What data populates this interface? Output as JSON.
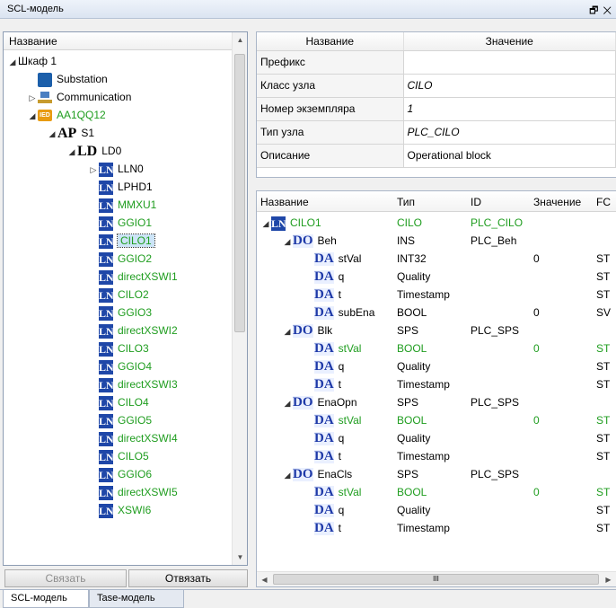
{
  "window": {
    "title": "SCL-модель",
    "pin_glyph": "🗗",
    "close_glyph": "✕"
  },
  "tree_panel": {
    "header": "Название",
    "items": [
      {
        "label": "Шкаф 1",
        "kind": "folder",
        "depth": 0,
        "expander": "◢",
        "color": "normal"
      },
      {
        "label": "Substation",
        "kind": "substation",
        "depth": 1,
        "expander": "",
        "color": "normal"
      },
      {
        "label": "Communication",
        "kind": "communication",
        "depth": 1,
        "expander": "▷",
        "color": "normal"
      },
      {
        "label": "AA1QQ12",
        "kind": "ied",
        "depth": 1,
        "expander": "◢",
        "color": "green",
        "icon_text": "IED"
      },
      {
        "label": "S1",
        "kind": "ap",
        "depth": 2,
        "expander": "◢",
        "color": "normal",
        "icon_text": "AP"
      },
      {
        "label": "LD0",
        "kind": "ld",
        "depth": 3,
        "expander": "◢",
        "color": "normal",
        "icon_text": "LD"
      },
      {
        "label": "LLN0",
        "kind": "ln",
        "depth": 4,
        "expander": "▷",
        "color": "normal"
      },
      {
        "label": "LPHD1",
        "kind": "ln",
        "depth": 4,
        "expander": "",
        "color": "normal"
      },
      {
        "label": "MMXU1",
        "kind": "ln",
        "depth": 4,
        "expander": "",
        "color": "green"
      },
      {
        "label": "GGIO1",
        "kind": "ln",
        "depth": 4,
        "expander": "",
        "color": "green"
      },
      {
        "label": "CILO1",
        "kind": "ln",
        "depth": 4,
        "expander": "",
        "color": "green",
        "selected": true
      },
      {
        "label": "GGIO2",
        "kind": "ln",
        "depth": 4,
        "expander": "",
        "color": "green"
      },
      {
        "label": "directXSWI1",
        "kind": "ln",
        "depth": 4,
        "expander": "",
        "color": "green"
      },
      {
        "label": "CILO2",
        "kind": "ln",
        "depth": 4,
        "expander": "",
        "color": "green"
      },
      {
        "label": "GGIO3",
        "kind": "ln",
        "depth": 4,
        "expander": "",
        "color": "green"
      },
      {
        "label": "directXSWI2",
        "kind": "ln",
        "depth": 4,
        "expander": "",
        "color": "green"
      },
      {
        "label": "CILO3",
        "kind": "ln",
        "depth": 4,
        "expander": "",
        "color": "green"
      },
      {
        "label": "GGIO4",
        "kind": "ln",
        "depth": 4,
        "expander": "",
        "color": "green"
      },
      {
        "label": "directXSWI3",
        "kind": "ln",
        "depth": 4,
        "expander": "",
        "color": "green"
      },
      {
        "label": "CILO4",
        "kind": "ln",
        "depth": 4,
        "expander": "",
        "color": "green"
      },
      {
        "label": "GGIO5",
        "kind": "ln",
        "depth": 4,
        "expander": "",
        "color": "green"
      },
      {
        "label": "directXSWI4",
        "kind": "ln",
        "depth": 4,
        "expander": "",
        "color": "green"
      },
      {
        "label": "CILO5",
        "kind": "ln",
        "depth": 4,
        "expander": "",
        "color": "green"
      },
      {
        "label": "GGIO6",
        "kind": "ln",
        "depth": 4,
        "expander": "",
        "color": "green"
      },
      {
        "label": "directXSWI5",
        "kind": "ln",
        "depth": 4,
        "expander": "",
        "color": "green"
      },
      {
        "label": "XSWI6",
        "kind": "ln",
        "depth": 4,
        "expander": "",
        "color": "green"
      }
    ],
    "ln_icon_text": "LN"
  },
  "buttons": {
    "bind": "Связать",
    "unbind": "Отвязать"
  },
  "properties": {
    "headers": [
      "Название",
      "Значение"
    ],
    "rows": [
      {
        "name": "Префикс",
        "value": ""
      },
      {
        "name": "Класс узла",
        "value": "CILO"
      },
      {
        "name": "Номер экземпляра",
        "value": "1"
      },
      {
        "name": "Тип узла",
        "value": "PLC_CILO"
      },
      {
        "name": "Описание",
        "value": "Operational block"
      }
    ]
  },
  "grid": {
    "headers": [
      "Название",
      "Тип",
      "ID",
      "Значение",
      "FC"
    ],
    "rows": [
      {
        "kind": "LN",
        "expander": "◢",
        "depth": 0,
        "name": "CILO1",
        "type": "CILO",
        "id": "PLC_CILO",
        "value": "",
        "fc": "",
        "green": true
      },
      {
        "kind": "DO",
        "expander": "◢",
        "depth": 1,
        "name": "Beh",
        "type": "INS",
        "id": "PLC_Beh",
        "value": "",
        "fc": "",
        "green": false
      },
      {
        "kind": "DA",
        "expander": "",
        "depth": 2,
        "name": "stVal",
        "type": "INT32",
        "id": "",
        "value": "0",
        "fc": "ST",
        "green": false
      },
      {
        "kind": "DA",
        "expander": "",
        "depth": 2,
        "name": "q",
        "type": "Quality",
        "id": "",
        "value": "",
        "fc": "ST",
        "green": false
      },
      {
        "kind": "DA",
        "expander": "",
        "depth": 2,
        "name": "t",
        "type": "Timestamp",
        "id": "",
        "value": "",
        "fc": "ST",
        "green": false
      },
      {
        "kind": "DA",
        "expander": "",
        "depth": 2,
        "name": "subEna",
        "type": "BOOL",
        "id": "",
        "value": "0",
        "fc": "SV",
        "green": false
      },
      {
        "kind": "DO",
        "expander": "◢",
        "depth": 1,
        "name": "Blk",
        "type": "SPS",
        "id": "PLC_SPS",
        "value": "",
        "fc": "",
        "green": false
      },
      {
        "kind": "DA",
        "expander": "",
        "depth": 2,
        "name": "stVal",
        "type": "BOOL",
        "id": "",
        "value": "0",
        "fc": "ST",
        "green": true
      },
      {
        "kind": "DA",
        "expander": "",
        "depth": 2,
        "name": "q",
        "type": "Quality",
        "id": "",
        "value": "",
        "fc": "ST",
        "green": false
      },
      {
        "kind": "DA",
        "expander": "",
        "depth": 2,
        "name": "t",
        "type": "Timestamp",
        "id": "",
        "value": "",
        "fc": "ST",
        "green": false
      },
      {
        "kind": "DO",
        "expander": "◢",
        "depth": 1,
        "name": "EnaOpn",
        "type": "SPS",
        "id": "PLC_SPS",
        "value": "",
        "fc": "",
        "green": false
      },
      {
        "kind": "DA",
        "expander": "",
        "depth": 2,
        "name": "stVal",
        "type": "BOOL",
        "id": "",
        "value": "0",
        "fc": "ST",
        "green": true
      },
      {
        "kind": "DA",
        "expander": "",
        "depth": 2,
        "name": "q",
        "type": "Quality",
        "id": "",
        "value": "",
        "fc": "ST",
        "green": false
      },
      {
        "kind": "DA",
        "expander": "",
        "depth": 2,
        "name": "t",
        "type": "Timestamp",
        "id": "",
        "value": "",
        "fc": "ST",
        "green": false
      },
      {
        "kind": "DO",
        "expander": "◢",
        "depth": 1,
        "name": "EnaCls",
        "type": "SPS",
        "id": "PLC_SPS",
        "value": "",
        "fc": "",
        "green": false
      },
      {
        "kind": "DA",
        "expander": "",
        "depth": 2,
        "name": "stVal",
        "type": "BOOL",
        "id": "",
        "value": "0",
        "fc": "ST",
        "green": true
      },
      {
        "kind": "DA",
        "expander": "",
        "depth": 2,
        "name": "q",
        "type": "Quality",
        "id": "",
        "value": "",
        "fc": "ST",
        "green": false
      },
      {
        "kind": "DA",
        "expander": "",
        "depth": 2,
        "name": "t",
        "type": "Timestamp",
        "id": "",
        "value": "",
        "fc": "ST",
        "green": false
      }
    ],
    "scroll_marker": "III"
  },
  "tabs": [
    {
      "label": "SCL-модель",
      "active": true
    },
    {
      "label": "Tase-модель",
      "active": false
    }
  ],
  "colors": {
    "green": "#1f9d1f",
    "icon_blue": "#1f47a8",
    "selection": "#cce4f7"
  }
}
